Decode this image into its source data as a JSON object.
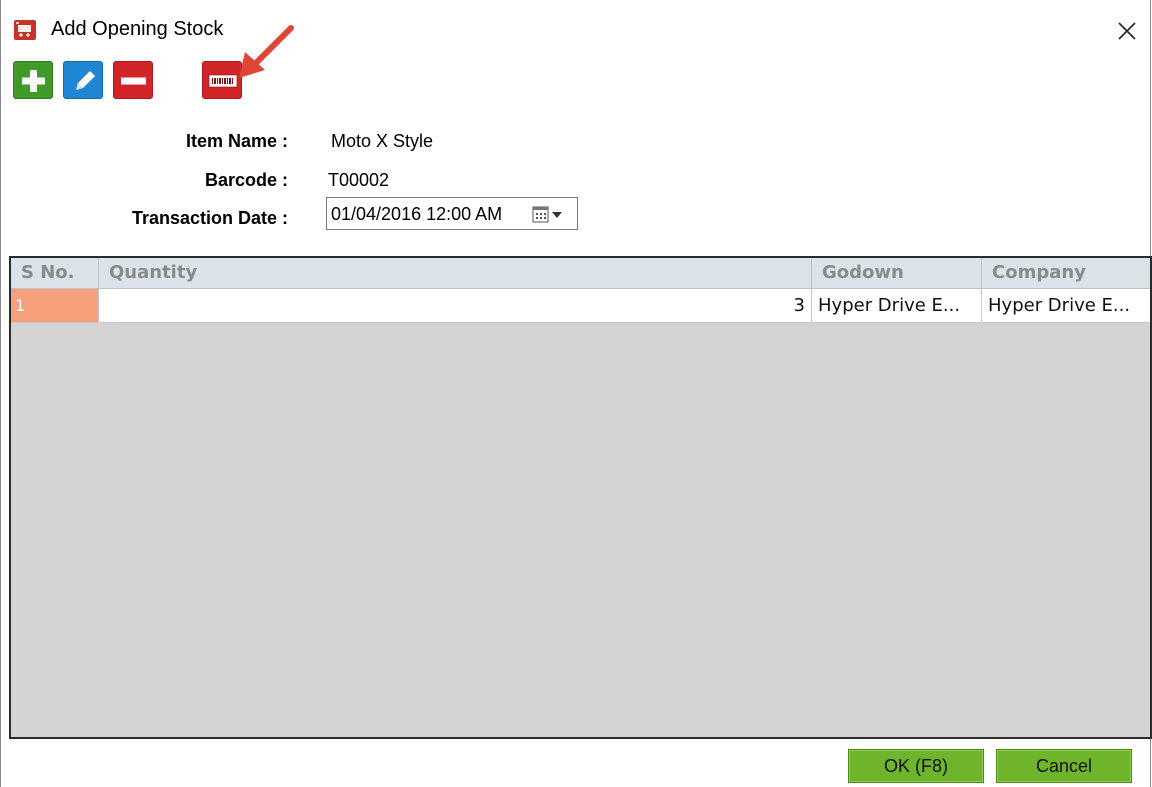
{
  "window": {
    "title": "Add Opening Stock",
    "accent_color": "#d2252a"
  },
  "toolbar": {
    "icons": [
      "plus-icon",
      "pencil-icon",
      "minus-icon",
      "barcode-icon"
    ]
  },
  "form": {
    "item_name_label": "Item Name :",
    "item_name_value": "Moto X Style",
    "barcode_label": "Barcode :",
    "barcode_value": "T00002",
    "transaction_date_label": "Transaction Date :",
    "transaction_date_value": "01/04/2016 12:00 AM"
  },
  "grid": {
    "columns": [
      "S No.",
      "Quantity",
      "Godown",
      "Company"
    ],
    "rows": [
      {
        "sno": "1",
        "quantity": "3",
        "godown": "Hyper Drive E...",
        "company": "Hyper Drive E..."
      }
    ]
  },
  "footer": {
    "ok_label": "OK (F8)",
    "cancel_label": "Cancel",
    "button_color": "#6fb52c"
  }
}
